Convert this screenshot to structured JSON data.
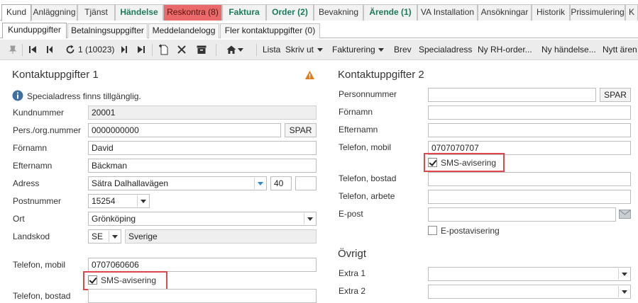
{
  "tabs_top": [
    {
      "label": "Kund"
    },
    {
      "label": "Anläggning"
    },
    {
      "label": "Tjänst"
    },
    {
      "label": "Händelse"
    },
    {
      "label": "Reskontra (8)"
    },
    {
      "label": "Faktura"
    },
    {
      "label": "Order (2)"
    },
    {
      "label": "Bevakning"
    },
    {
      "label": "Ärende (1)"
    },
    {
      "label": "VA Installation"
    },
    {
      "label": "Ansökningar"
    },
    {
      "label": "Historik"
    },
    {
      "label": "Prissimulering"
    },
    {
      "label": "K"
    }
  ],
  "tabs_sub": [
    {
      "label": "Kunduppgifter"
    },
    {
      "label": "Betalningsuppgifter"
    },
    {
      "label": "Meddelandelogg"
    },
    {
      "label": "Fler kontaktuppgifter (0)"
    }
  ],
  "toolbar": {
    "record_counter": "1 (10023)",
    "lista": "Lista",
    "skriv_ut": "Skriv ut",
    "fakturering": "Fakturering",
    "brev": "Brev",
    "specialadress": "Specialadress",
    "ny_rh_order": "Ny RH-order...",
    "ny_handelse": "Ny händelse...",
    "nytt_arende": "Nytt ären"
  },
  "contact1": {
    "title": "Kontaktuppgifter 1",
    "info": "Specialadress finns tillgänglig.",
    "kundnummer_label": "Kundnummer",
    "kundnummer": "20001",
    "persorg_label": "Pers./org.nummer",
    "persorg": "0000000000",
    "spar": "SPAR",
    "fornamn_label": "Förnamn",
    "fornamn": "David",
    "efternamn_label": "Efternamn",
    "efternamn": "Bäckman",
    "adress_label": "Adress",
    "adress": "Sätra Dalhallavägen",
    "adress_nr": "40",
    "postnummer_label": "Postnummer",
    "postnummer": "15254",
    "ort_label": "Ort",
    "ort": "Grönköping",
    "landskod_label": "Landskod",
    "landskod": "SE",
    "land": "Sverige",
    "tel_mobil_label": "Telefon, mobil",
    "tel_mobil": "0707060606",
    "sms_label": "SMS-avisering",
    "tel_bostad_label": "Telefon, bostad"
  },
  "contact2": {
    "title": "Kontaktuppgifter 2",
    "personnummer_label": "Personnummer",
    "spar": "SPAR",
    "fornamn_label": "Förnamn",
    "efternamn_label": "Efternamn",
    "tel_mobil_label": "Telefon, mobil",
    "tel_mobil": "0707070707",
    "sms_label": "SMS-avisering",
    "tel_bostad_label": "Telefon, bostad",
    "tel_arbete_label": "Telefon, arbete",
    "epost_label": "E-post",
    "epostavisering_label": "E-postavisering"
  },
  "ovrigt": {
    "title": "Övrigt",
    "extra1_label": "Extra 1",
    "extra2_label": "Extra 2"
  },
  "colors": {
    "reskontra_tab": "#ea6a6a",
    "green_tab_text": "#1d7a58",
    "highlight": "#e0474c",
    "warning": "#e07b1a",
    "info": "#3d6fa3"
  }
}
